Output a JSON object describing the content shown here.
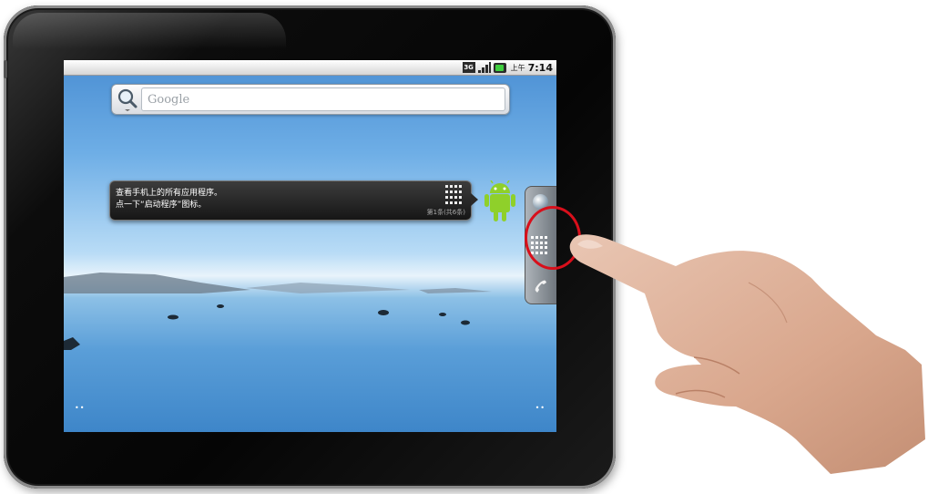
{
  "statusbar": {
    "network": "3G",
    "ampm": "上午",
    "time": "7:14"
  },
  "search": {
    "placeholder": "Google"
  },
  "tip": {
    "line1": "查看手机上的所有应用程序。",
    "line2": "点一下“启动程序”图标。",
    "page": "第1条(共6条)"
  },
  "home": {
    "left_dots": "••",
    "right_dots": "••"
  },
  "icons": {
    "search": "search-icon",
    "apps": "app-grid-icon",
    "phone": "phone-icon",
    "browser": "globe-icon"
  },
  "colors": {
    "highlight": "#d80f1b",
    "battery": "#3fcf3f"
  }
}
